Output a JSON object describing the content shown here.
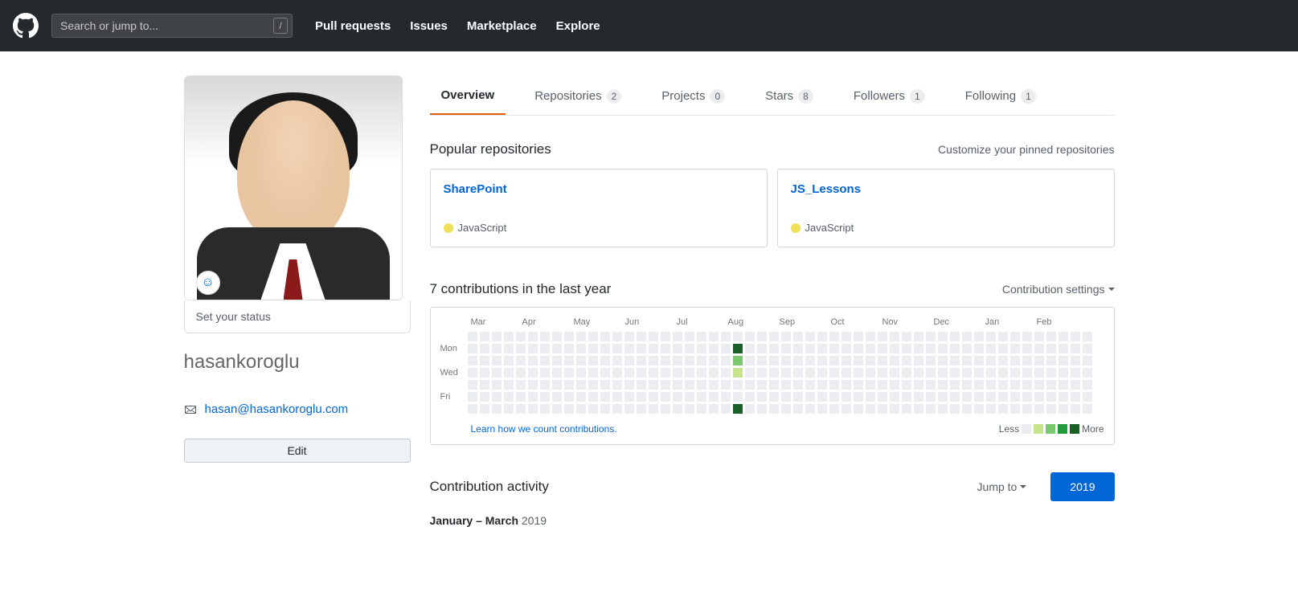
{
  "header": {
    "search_placeholder": "Search or jump to...",
    "slash": "/",
    "nav": [
      "Pull requests",
      "Issues",
      "Marketplace",
      "Explore"
    ]
  },
  "profile": {
    "status_prompt": "Set your status",
    "username": "hasankoroglu",
    "email": "hasan@hasankoroglu.com",
    "edit_label": "Edit"
  },
  "tabs": [
    {
      "label": "Overview",
      "count": null,
      "active": true
    },
    {
      "label": "Repositories",
      "count": "2",
      "active": false
    },
    {
      "label": "Projects",
      "count": "0",
      "active": false
    },
    {
      "label": "Stars",
      "count": "8",
      "active": false
    },
    {
      "label": "Followers",
      "count": "1",
      "active": false
    },
    {
      "label": "Following",
      "count": "1",
      "active": false
    }
  ],
  "popular": {
    "title": "Popular repositories",
    "customize": "Customize your pinned repositories",
    "repos": [
      {
        "name": "SharePoint",
        "lang": "JavaScript",
        "lang_color": "#f1e05a"
      },
      {
        "name": "JS_Lessons",
        "lang": "JavaScript",
        "lang_color": "#f1e05a"
      }
    ]
  },
  "contrib": {
    "title": "7 contributions in the last year",
    "settings_label": "Contribution settings",
    "months": [
      "Mar",
      "Apr",
      "May",
      "Jun",
      "Jul",
      "Aug",
      "Sep",
      "Oct",
      "Nov",
      "Dec",
      "Jan",
      "Feb"
    ],
    "day_labels": [
      "Mon",
      "Wed",
      "Fri"
    ],
    "learn_link": "Learn how we count contributions.",
    "legend_less": "Less",
    "legend_more": "More"
  },
  "activity": {
    "title": "Contribution activity",
    "jump_to": "Jump to",
    "year": "2019",
    "range_bold": "January – March",
    "range_year": "2019"
  }
}
